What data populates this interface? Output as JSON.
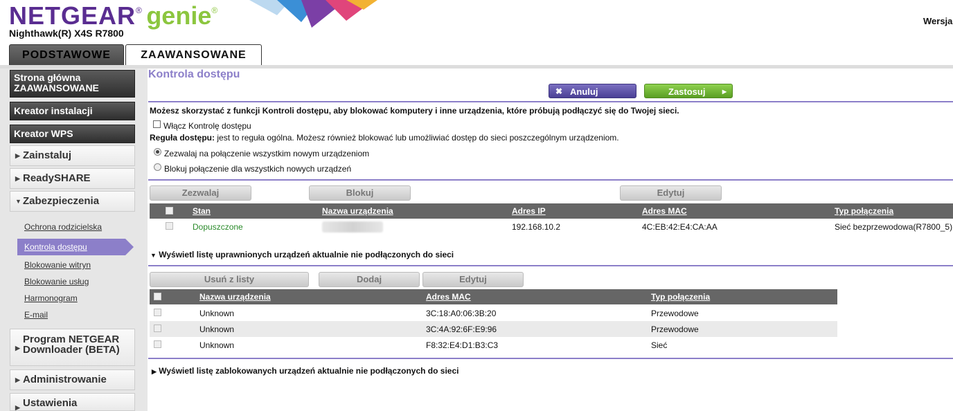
{
  "header": {
    "brand": "NETGEAR",
    "reg": "®",
    "product": "genie",
    "model": "Nighthawk(R) X4S R7800",
    "version_label": "Wersja"
  },
  "tabs": [
    {
      "label": "PODSTAWOWE",
      "active": false
    },
    {
      "label": "ZAAWANSOWANE",
      "active": true
    }
  ],
  "sidebar": {
    "home_line1": "Strona główna",
    "home_line2": "ZAAWANSOWANE",
    "setup_wizard": "Kreator instalacji",
    "wps_wizard": "Kreator WPS",
    "install": "Zainstaluj",
    "readyshare": "ReadySHARE",
    "security": "Zabezpieczenia",
    "security_items": [
      "Ochrona rodzicielska",
      "Kontrola dostępu",
      "Blokowanie witryn",
      "Blokowanie usług",
      "Harmonogram",
      "E-mail"
    ],
    "downloader": "Program NETGEAR Downloader (BETA)",
    "admin": "Administrowanie",
    "settings": "Ustawienia"
  },
  "main": {
    "title": "Kontrola dostępu",
    "cancel_label": "Anuluj",
    "apply_label": "Zastosuj",
    "intro": "Możesz skorzystać z funkcji Kontroli dostępu, aby blokować komputery i inne urządzenia, które próbują podłączyć się do Twojej sieci.",
    "enable_checkbox_label": "Włącz Kontrolę dostępu",
    "rule_bold": "Reguła dostępu:",
    "rule_text": " jest to reguła ogólna. Możesz również blokować lub umożliwiać dostęp do sieci poszczególnym urządzeniom.",
    "radio_allow": "Zezwalaj na połączenie wszystkim nowym urządzeniom",
    "radio_block": "Blokuj połączenie dla wszystkich nowych urządzeń",
    "btn_allow": "Zezwalaj",
    "btn_block": "Blokuj",
    "btn_edit": "Edytuj",
    "table1": {
      "headers": [
        "Stan",
        "Nazwa urządzenia",
        "Adres IP",
        "Adres MAC",
        "Typ połączenia"
      ],
      "rows": [
        {
          "status": "Dopuszczone",
          "name": "",
          "ip": "192.168.10.2",
          "mac": "4C:EB:42:E4:CA:AA",
          "type": "Sieć bezprzewodowa(R7800_5)"
        }
      ]
    },
    "allowed_offline_toggle": "Wyświetl listę uprawnionych urządzeń aktualnie nie podłączonych do sieci",
    "btn_remove": "Usuń z listy",
    "btn_add": "Dodaj",
    "btn_edit2": "Edytuj",
    "table2": {
      "headers": [
        "Nazwa urządzenia",
        "Adres MAC",
        "Typ połączenia"
      ],
      "rows": [
        {
          "name": "Unknown",
          "mac": "3C:18:A0:06:3B:20",
          "type": "Przewodowe"
        },
        {
          "name": "Unknown",
          "mac": "3C:4A:92:6F:E9:96",
          "type": "Przewodowe"
        },
        {
          "name": "Unknown",
          "mac": "F8:32:E4:D1:B3:C3",
          "type": "Sieć"
        }
      ]
    },
    "blocked_offline_toggle": "Wyświetl listę zablokowanych urządzeń aktualnie nie podłączonych do sieci"
  },
  "colors": {
    "accent_purple": "#8c7fc9",
    "apply_green": "#6fb52f",
    "status_green": "#2a8a2a",
    "table_header": "#666666"
  }
}
